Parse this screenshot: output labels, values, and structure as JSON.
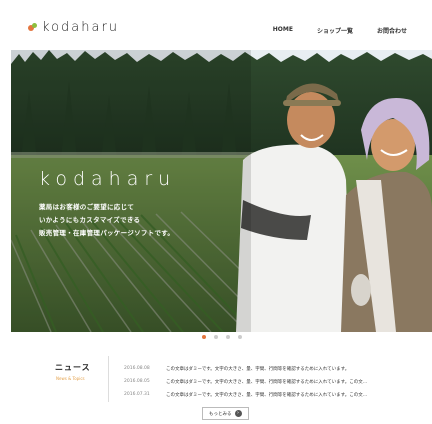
{
  "header": {
    "logo_text": "kodaharu",
    "nav": [
      "HOME",
      "ショップ一覧",
      "お問合わせ"
    ]
  },
  "hero": {
    "brand": "kodaharu",
    "copy": [
      "薬局はお客様のご要望に応じて",
      "いかようにもカスタマイズできる",
      "販売管理・在庫管理パッケージソフトです。"
    ]
  },
  "carousel": {
    "slide_count": 4,
    "active_index": 0
  },
  "news": {
    "title": "ニュース",
    "subtitle": "News & Topics",
    "items": [
      {
        "date": "2016.08.08",
        "text": "この文章はダミーです。文字の大きさ、量、字間、行間等を確認するために入れています。"
      },
      {
        "date": "2016.08.05",
        "text": "この文章はダミーです。文字の大きさ、量、字間、行間等を確認するために入れています。この文…"
      },
      {
        "date": "2016.07.31",
        "text": "この文章はダミーです。文字の大きさ、量、字間、行間等を確認するために入れています。この文…"
      }
    ],
    "more_label": "もっとみる"
  },
  "colors": {
    "accent": "#e4763f",
    "leaf": "#8cbf3f",
    "news_sub": "#e4a14a"
  }
}
